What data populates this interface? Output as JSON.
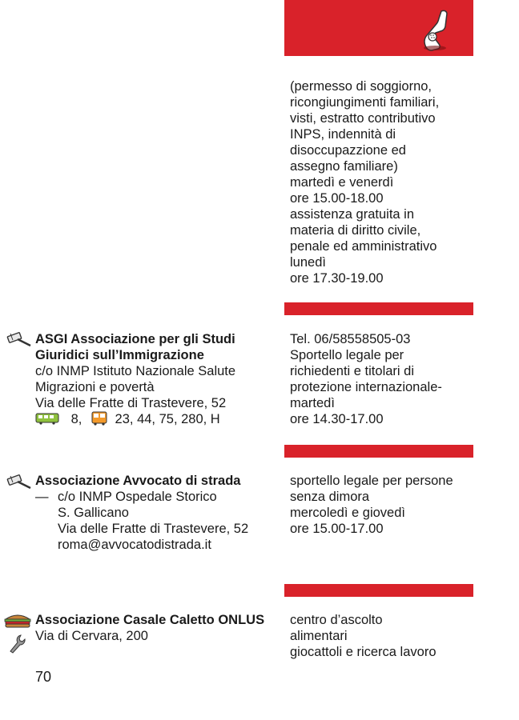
{
  "page": {
    "number": "70"
  },
  "header": {
    "icon": "telephone-icon",
    "color": "#d9222a"
  },
  "top_block": {
    "lines": [
      "(permesso di soggiorno,",
      "ricongiungimenti familiari,",
      "visti, estratto contributivo",
      "INPS, indennità di",
      "disoccupazzione ed",
      "assegno familiare)",
      "martedì e venerdì",
      "ore 15.00-18.00",
      "assistenza gratuita in",
      "materia di diritto civile,",
      "penale ed amministrativo",
      "lunedì",
      "ore 17.30-19.00"
    ]
  },
  "entries": [
    {
      "icon": "legal-hammer-icon",
      "name_lines": [
        "ASGI Associazione per gli Studi",
        "Giuridici sull’Immigrazione"
      ],
      "address_lines": [
        "c/o INMP Istituto Nazionale Salute",
        "Migrazioni e povertà",
        "Via delle Fratte di Trastevere, 52"
      ],
      "transport": {
        "tram_icon": "tram-icon",
        "tram": "8,",
        "bus_icon": "bus-icon",
        "bus": "23, 44, 75, 280, H"
      },
      "info_lines": [
        "Tel. 06/58558505-03",
        "Sportello legale per",
        "richiedenti e titolari di",
        "protezione internazionale-",
        "martedì",
        "ore 14.30-17.00"
      ]
    },
    {
      "icon": "legal-hammer-icon",
      "name_lines": [
        "Associazione Avvocato di strada"
      ],
      "dash": "—",
      "address_lines": [
        "c/o INMP Ospedale Storico",
        "S. Gallicano",
        "Via delle Fratte di Trastevere, 52",
        "roma@avvocatodistrada.it"
      ],
      "info_lines": [
        "sportello legale per persone",
        "senza dimora",
        "mercoledì e giovedì",
        "ore 15.00-17.00"
      ]
    },
    {
      "icon": "sandwich-icon",
      "icon2": "wrench-icon",
      "name_lines": [
        "Associazione Casale Caletto ONLUS"
      ],
      "address_lines": [
        "Via di Cervara, 200"
      ],
      "info_lines": [
        "centro d’ascolto",
        "alimentari",
        "giocattoli e ricerca lavoro"
      ]
    }
  ]
}
